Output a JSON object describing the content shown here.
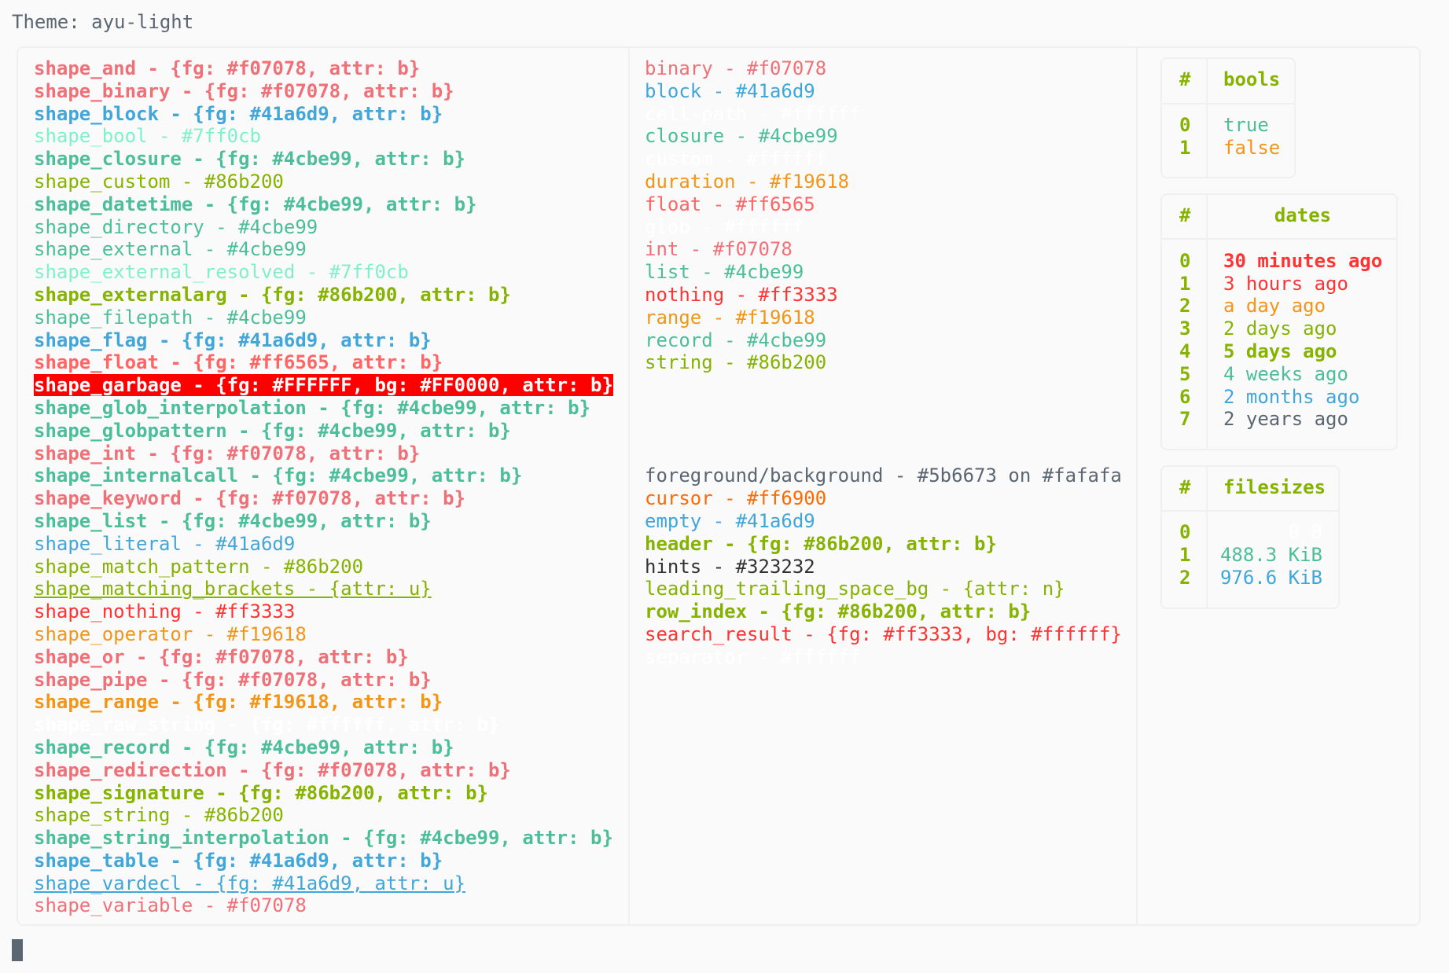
{
  "title": "Theme: ayu-light",
  "colors": {
    "background": "#fafafa",
    "foreground": "#5b6673"
  },
  "left_column": [
    {
      "text": "shape_and - {fg: #f07078, attr: b}",
      "fg": "#f07078",
      "bold": true
    },
    {
      "text": "shape_binary - {fg: #f07078, attr: b}",
      "fg": "#f07078",
      "bold": true
    },
    {
      "text": "shape_block - {fg: #41a6d9, attr: b}",
      "fg": "#41a6d9",
      "bold": true
    },
    {
      "text": "shape_bool - #7ff0cb",
      "fg": "#7ff0cb"
    },
    {
      "text": "shape_closure - {fg: #4cbe99, attr: b}",
      "fg": "#4cbe99",
      "bold": true
    },
    {
      "text": "shape_custom - #86b200",
      "fg": "#86b200"
    },
    {
      "text": "shape_datetime - {fg: #4cbe99, attr: b}",
      "fg": "#4cbe99",
      "bold": true
    },
    {
      "text": "shape_directory - #4cbe99",
      "fg": "#4cbe99"
    },
    {
      "text": "shape_external - #4cbe99",
      "fg": "#4cbe99"
    },
    {
      "text": "shape_external_resolved - #7ff0cb",
      "fg": "#7ff0cb"
    },
    {
      "text": "shape_externalarg - {fg: #86b200, attr: b}",
      "fg": "#86b200",
      "bold": true
    },
    {
      "text": "shape_filepath - #4cbe99",
      "fg": "#4cbe99"
    },
    {
      "text": "shape_flag - {fg: #41a6d9, attr: b}",
      "fg": "#41a6d9",
      "bold": true
    },
    {
      "text": "shape_float - {fg: #ff6565, attr: b}",
      "fg": "#ff6565",
      "bold": true
    },
    {
      "text": "shape_garbage - {fg: #FFFFFF, bg: #FF0000, attr: b}",
      "fg": "#ffffff",
      "bg": "#ff0000",
      "bold": true
    },
    {
      "text": "shape_glob_interpolation - {fg: #4cbe99, attr: b}",
      "fg": "#4cbe99",
      "bold": true
    },
    {
      "text": "shape_globpattern - {fg: #4cbe99, attr: b}",
      "fg": "#4cbe99",
      "bold": true
    },
    {
      "text": "shape_int - {fg: #f07078, attr: b}",
      "fg": "#f07078",
      "bold": true
    },
    {
      "text": "shape_internalcall - {fg: #4cbe99, attr: b}",
      "fg": "#4cbe99",
      "bold": true
    },
    {
      "text": "shape_keyword - {fg: #f07078, attr: b}",
      "fg": "#f07078",
      "bold": true
    },
    {
      "text": "shape_list - {fg: #4cbe99, attr: b}",
      "fg": "#4cbe99",
      "bold": true
    },
    {
      "text": "shape_literal - #41a6d9",
      "fg": "#41a6d9"
    },
    {
      "text": "shape_match_pattern - #86b200",
      "fg": "#86b200"
    },
    {
      "text": "shape_matching_brackets - {attr: u}",
      "fg": "#86b200",
      "underline": true
    },
    {
      "text": "shape_nothing - #ff3333",
      "fg": "#ff3333"
    },
    {
      "text": "shape_operator - #f19618",
      "fg": "#f19618"
    },
    {
      "text": "shape_or - {fg: #f07078, attr: b}",
      "fg": "#f07078",
      "bold": true
    },
    {
      "text": "shape_pipe - {fg: #f07078, attr: b}",
      "fg": "#f07078",
      "bold": true
    },
    {
      "text": "shape_range - {fg: #f19618, attr: b}",
      "fg": "#f19618",
      "bold": true
    },
    {
      "text": "shape_raw_string - {fg: #ffffff, attr: b}",
      "fg": "#ffffff",
      "bold": true
    },
    {
      "text": "shape_record - {fg: #4cbe99, attr: b}",
      "fg": "#4cbe99",
      "bold": true
    },
    {
      "text": "shape_redirection - {fg: #f07078, attr: b}",
      "fg": "#f07078",
      "bold": true
    },
    {
      "text": "shape_signature - {fg: #86b200, attr: b}",
      "fg": "#86b200",
      "bold": true
    },
    {
      "text": "shape_string - #86b200",
      "fg": "#86b200"
    },
    {
      "text": "shape_string_interpolation - {fg: #4cbe99, attr: b}",
      "fg": "#4cbe99",
      "bold": true
    },
    {
      "text": "shape_table - {fg: #41a6d9, attr: b}",
      "fg": "#41a6d9",
      "bold": true
    },
    {
      "text": "shape_vardecl - {fg: #41a6d9, attr: u}",
      "fg": "#41a6d9",
      "underline": true
    },
    {
      "text": "shape_variable - #f07078",
      "fg": "#f07078"
    }
  ],
  "middle_column": [
    {
      "text": "binary - #f07078",
      "fg": "#f07078"
    },
    {
      "text": "block - #41a6d9",
      "fg": "#41a6d9"
    },
    {
      "text": "cell-path - #ffffff",
      "fg": "#ffffff"
    },
    {
      "text": "closure - #4cbe99",
      "fg": "#4cbe99"
    },
    {
      "text": "custom - #ffffff",
      "fg": "#ffffff"
    },
    {
      "text": "duration - #f19618",
      "fg": "#f19618"
    },
    {
      "text": "float - #ff6565",
      "fg": "#ff6565"
    },
    {
      "text": "glob - #ffffff",
      "fg": "#ffffff"
    },
    {
      "text": "int - #f07078",
      "fg": "#f07078"
    },
    {
      "text": "list - #4cbe99",
      "fg": "#4cbe99"
    },
    {
      "text": "nothing - #ff3333",
      "fg": "#ff3333"
    },
    {
      "text": "range - #f19618",
      "fg": "#f19618"
    },
    {
      "text": "record - #4cbe99",
      "fg": "#4cbe99"
    },
    {
      "text": "string - #86b200",
      "fg": "#86b200"
    },
    {
      "text": ""
    },
    {
      "text": ""
    },
    {
      "text": ""
    },
    {
      "text": ""
    },
    {
      "text": "foreground/background - #5b6673 on #fafafa",
      "fg": "#5b6673"
    },
    {
      "text": "cursor - #ff6900",
      "fg": "#ff6900"
    },
    {
      "text": "empty - #41a6d9",
      "fg": "#41a6d9"
    },
    {
      "text": "header - {fg: #86b200, attr: b}",
      "fg": "#86b200",
      "bold": true
    },
    {
      "text": "hints - #323232",
      "fg": "#323232"
    },
    {
      "text": "leading_trailing_space_bg - {attr: n}",
      "fg": "#86b200"
    },
    {
      "text": "row_index - {fg: #86b200, attr: b}",
      "fg": "#86b200",
      "bold": true
    },
    {
      "text": "search_result - {fg: #ff3333, bg: #ffffff}",
      "fg": "#ff3333",
      "bg": "#ffffff"
    },
    {
      "text": "separator - #ffffff",
      "fg": "#ffffff"
    }
  ],
  "tables": [
    {
      "header_index": "#",
      "header": "bools",
      "align": "left",
      "rows": [
        {
          "index": "0",
          "value": "true",
          "fg": "#4cbe99"
        },
        {
          "index": "1",
          "value": "false",
          "fg": "#f19618"
        }
      ]
    },
    {
      "header_index": "#",
      "header": "dates",
      "align": "left",
      "rows": [
        {
          "index": "0",
          "value": "30 minutes ago",
          "fg": "#ff3333",
          "bold": true
        },
        {
          "index": "1",
          "value": "3 hours ago",
          "fg": "#ff3333"
        },
        {
          "index": "2",
          "value": "a day ago",
          "fg": "#f19618"
        },
        {
          "index": "3",
          "value": "2 days ago",
          "fg": "#86b200"
        },
        {
          "index": "4",
          "value": "5 days ago",
          "fg": "#86b200",
          "bold": true
        },
        {
          "index": "5",
          "value": "4 weeks ago",
          "fg": "#4cbe99"
        },
        {
          "index": "6",
          "value": "2 months ago",
          "fg": "#41a6d9"
        },
        {
          "index": "7",
          "value": "2 years ago",
          "fg": "#5b6673"
        }
      ]
    },
    {
      "header_index": "#",
      "header": "filesizes",
      "align": "right",
      "rows": [
        {
          "index": "0",
          "value": "0 B",
          "fg": "#ffffff"
        },
        {
          "index": "1",
          "value": "488.3 KiB",
          "fg": "#4cbe99"
        },
        {
          "index": "2",
          "value": "976.6 KiB",
          "fg": "#41a6d9"
        }
      ]
    }
  ]
}
